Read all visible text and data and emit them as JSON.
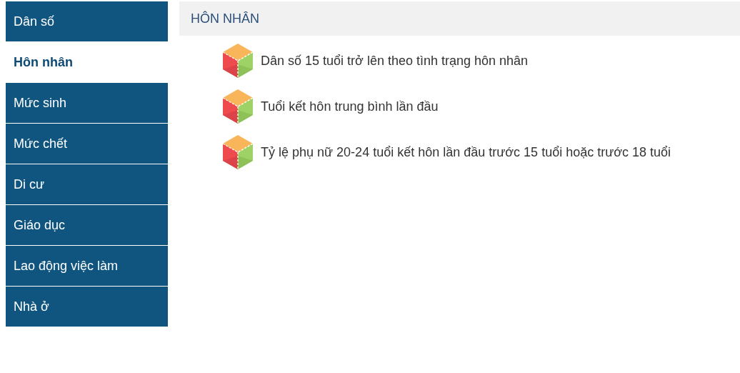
{
  "sidebar": {
    "items": [
      {
        "label": "Dân số",
        "selected": false
      },
      {
        "label": "Hôn nhân",
        "selected": true
      },
      {
        "label": "Mức sinh",
        "selected": false
      },
      {
        "label": "Mức chết",
        "selected": false
      },
      {
        "label": "Di cư",
        "selected": false
      },
      {
        "label": "Giáo dục",
        "selected": false
      },
      {
        "label": "Lao động việc làm",
        "selected": false
      },
      {
        "label": "Nhà ở",
        "selected": false
      }
    ]
  },
  "section": {
    "title": "HÔN NHÂN",
    "links": [
      "Dân số 15 tuổi trở lên theo tình trạng hôn nhân",
      "Tuổi kết hôn trung bình lần đầu",
      "Tỷ lệ phụ nữ 20-24 tuổi kết hôn lần đầu trước 15 tuổi hoặc trước 18 tuổi"
    ]
  }
}
